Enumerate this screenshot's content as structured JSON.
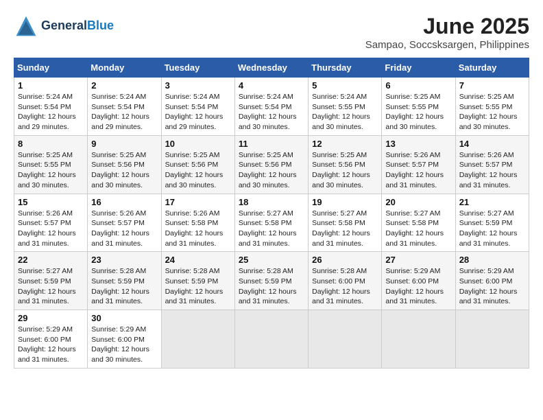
{
  "logo": {
    "line1": "General",
    "line2": "Blue"
  },
  "title": "June 2025",
  "subtitle": "Sampao, Soccsksargen, Philippines",
  "weekdays": [
    "Sunday",
    "Monday",
    "Tuesday",
    "Wednesday",
    "Thursday",
    "Friday",
    "Saturday"
  ],
  "weeks": [
    [
      {
        "day": "1",
        "sunrise": "Sunrise: 5:24 AM",
        "sunset": "Sunset: 5:54 PM",
        "daylight": "Daylight: 12 hours and 29 minutes."
      },
      {
        "day": "2",
        "sunrise": "Sunrise: 5:24 AM",
        "sunset": "Sunset: 5:54 PM",
        "daylight": "Daylight: 12 hours and 29 minutes."
      },
      {
        "day": "3",
        "sunrise": "Sunrise: 5:24 AM",
        "sunset": "Sunset: 5:54 PM",
        "daylight": "Daylight: 12 hours and 29 minutes."
      },
      {
        "day": "4",
        "sunrise": "Sunrise: 5:24 AM",
        "sunset": "Sunset: 5:54 PM",
        "daylight": "Daylight: 12 hours and 30 minutes."
      },
      {
        "day": "5",
        "sunrise": "Sunrise: 5:24 AM",
        "sunset": "Sunset: 5:55 PM",
        "daylight": "Daylight: 12 hours and 30 minutes."
      },
      {
        "day": "6",
        "sunrise": "Sunrise: 5:25 AM",
        "sunset": "Sunset: 5:55 PM",
        "daylight": "Daylight: 12 hours and 30 minutes."
      },
      {
        "day": "7",
        "sunrise": "Sunrise: 5:25 AM",
        "sunset": "Sunset: 5:55 PM",
        "daylight": "Daylight: 12 hours and 30 minutes."
      }
    ],
    [
      {
        "day": "8",
        "sunrise": "Sunrise: 5:25 AM",
        "sunset": "Sunset: 5:55 PM",
        "daylight": "Daylight: 12 hours and 30 minutes."
      },
      {
        "day": "9",
        "sunrise": "Sunrise: 5:25 AM",
        "sunset": "Sunset: 5:56 PM",
        "daylight": "Daylight: 12 hours and 30 minutes."
      },
      {
        "day": "10",
        "sunrise": "Sunrise: 5:25 AM",
        "sunset": "Sunset: 5:56 PM",
        "daylight": "Daylight: 12 hours and 30 minutes."
      },
      {
        "day": "11",
        "sunrise": "Sunrise: 5:25 AM",
        "sunset": "Sunset: 5:56 PM",
        "daylight": "Daylight: 12 hours and 30 minutes."
      },
      {
        "day": "12",
        "sunrise": "Sunrise: 5:25 AM",
        "sunset": "Sunset: 5:56 PM",
        "daylight": "Daylight: 12 hours and 30 minutes."
      },
      {
        "day": "13",
        "sunrise": "Sunrise: 5:26 AM",
        "sunset": "Sunset: 5:57 PM",
        "daylight": "Daylight: 12 hours and 31 minutes."
      },
      {
        "day": "14",
        "sunrise": "Sunrise: 5:26 AM",
        "sunset": "Sunset: 5:57 PM",
        "daylight": "Daylight: 12 hours and 31 minutes."
      }
    ],
    [
      {
        "day": "15",
        "sunrise": "Sunrise: 5:26 AM",
        "sunset": "Sunset: 5:57 PM",
        "daylight": "Daylight: 12 hours and 31 minutes."
      },
      {
        "day": "16",
        "sunrise": "Sunrise: 5:26 AM",
        "sunset": "Sunset: 5:57 PM",
        "daylight": "Daylight: 12 hours and 31 minutes."
      },
      {
        "day": "17",
        "sunrise": "Sunrise: 5:26 AM",
        "sunset": "Sunset: 5:58 PM",
        "daylight": "Daylight: 12 hours and 31 minutes."
      },
      {
        "day": "18",
        "sunrise": "Sunrise: 5:27 AM",
        "sunset": "Sunset: 5:58 PM",
        "daylight": "Daylight: 12 hours and 31 minutes."
      },
      {
        "day": "19",
        "sunrise": "Sunrise: 5:27 AM",
        "sunset": "Sunset: 5:58 PM",
        "daylight": "Daylight: 12 hours and 31 minutes."
      },
      {
        "day": "20",
        "sunrise": "Sunrise: 5:27 AM",
        "sunset": "Sunset: 5:58 PM",
        "daylight": "Daylight: 12 hours and 31 minutes."
      },
      {
        "day": "21",
        "sunrise": "Sunrise: 5:27 AM",
        "sunset": "Sunset: 5:59 PM",
        "daylight": "Daylight: 12 hours and 31 minutes."
      }
    ],
    [
      {
        "day": "22",
        "sunrise": "Sunrise: 5:27 AM",
        "sunset": "Sunset: 5:59 PM",
        "daylight": "Daylight: 12 hours and 31 minutes."
      },
      {
        "day": "23",
        "sunrise": "Sunrise: 5:28 AM",
        "sunset": "Sunset: 5:59 PM",
        "daylight": "Daylight: 12 hours and 31 minutes."
      },
      {
        "day": "24",
        "sunrise": "Sunrise: 5:28 AM",
        "sunset": "Sunset: 5:59 PM",
        "daylight": "Daylight: 12 hours and 31 minutes."
      },
      {
        "day": "25",
        "sunrise": "Sunrise: 5:28 AM",
        "sunset": "Sunset: 5:59 PM",
        "daylight": "Daylight: 12 hours and 31 minutes."
      },
      {
        "day": "26",
        "sunrise": "Sunrise: 5:28 AM",
        "sunset": "Sunset: 6:00 PM",
        "daylight": "Daylight: 12 hours and 31 minutes."
      },
      {
        "day": "27",
        "sunrise": "Sunrise: 5:29 AM",
        "sunset": "Sunset: 6:00 PM",
        "daylight": "Daylight: 12 hours and 31 minutes."
      },
      {
        "day": "28",
        "sunrise": "Sunrise: 5:29 AM",
        "sunset": "Sunset: 6:00 PM",
        "daylight": "Daylight: 12 hours and 31 minutes."
      }
    ],
    [
      {
        "day": "29",
        "sunrise": "Sunrise: 5:29 AM",
        "sunset": "Sunset: 6:00 PM",
        "daylight": "Daylight: 12 hours and 31 minutes."
      },
      {
        "day": "30",
        "sunrise": "Sunrise: 5:29 AM",
        "sunset": "Sunset: 6:00 PM",
        "daylight": "Daylight: 12 hours and 30 minutes."
      },
      null,
      null,
      null,
      null,
      null
    ]
  ]
}
